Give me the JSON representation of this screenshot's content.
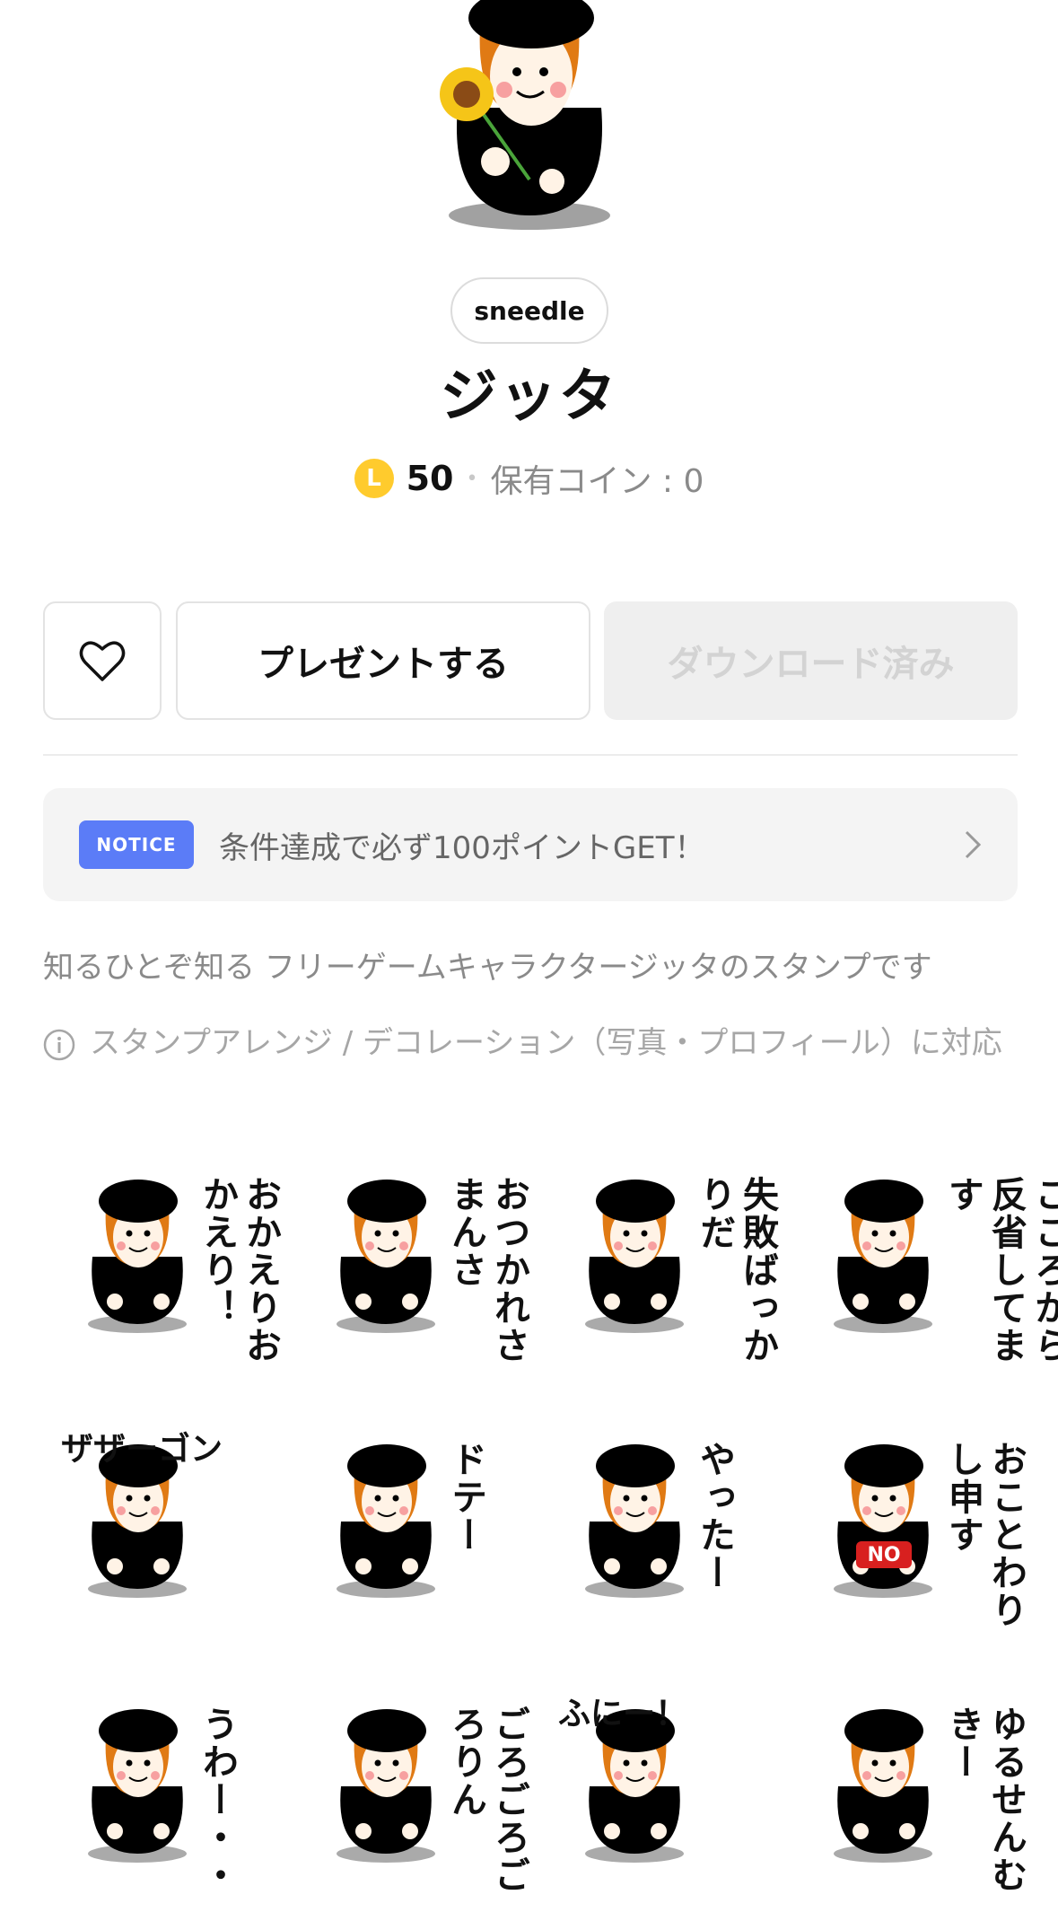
{
  "author": "sneedle",
  "title": "ジッタ",
  "price": {
    "coin_symbol": "L",
    "amount": "50",
    "separator": "•",
    "owned_text": "保有コイン : 0"
  },
  "buttons": {
    "gift": "プレゼントする",
    "download": "ダウンロード済み"
  },
  "notice": {
    "badge": "NOTICE",
    "text": "条件達成で必ず100ポイントGET！"
  },
  "description": "知るひとぞ知る フリーゲームキャラクタージッタのスタンプです",
  "feature": "スタンプアレンジ / デコレーション（写真・プロフィール）に対応",
  "stickers": [
    {
      "text": "おかえりおかえり！"
    },
    {
      "text": "おつかれさまんさ"
    },
    {
      "text": "失敗ばっかりだ"
    },
    {
      "text": "こころから反省してます"
    },
    {
      "text": "ザザーゴン"
    },
    {
      "text": "ドテー"
    },
    {
      "text": "やったー"
    },
    {
      "text": "おことわりし申す",
      "badge": "NO"
    },
    {
      "text": "うわー・・"
    },
    {
      "text": "ごろごろごろりん"
    },
    {
      "text": "ふにー！"
    },
    {
      "text": "ゆるせんむきー"
    }
  ]
}
